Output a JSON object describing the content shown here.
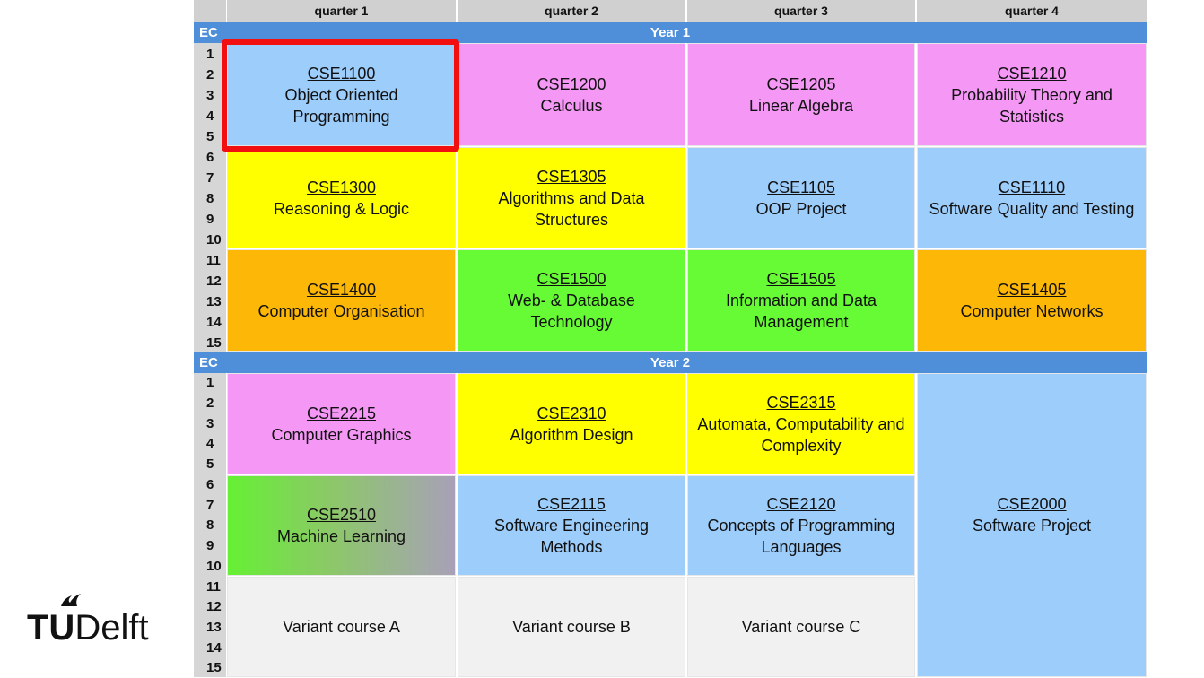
{
  "header": {
    "quarters": [
      "quarter 1",
      "quarter 2",
      "quarter 3",
      "quarter 4"
    ]
  },
  "year1": {
    "ec_label": "EC",
    "title": "Year 1",
    "ec_numbers": [
      "1",
      "2",
      "3",
      "4",
      "5",
      "6",
      "7",
      "8",
      "9",
      "10",
      "11",
      "12",
      "13",
      "14",
      "15"
    ],
    "courses": [
      {
        "code": "CSE1100",
        "name": "Object Oriented Programming",
        "color": "#9dcdfb"
      },
      {
        "code": "CSE1200",
        "name": "Calculus",
        "color": "#f597f5"
      },
      {
        "code": "CSE1205",
        "name": "Linear Algebra",
        "color": "#f597f5"
      },
      {
        "code": "CSE1210",
        "name": "Probability Theory and Statistics",
        "color": "#f597f5"
      },
      {
        "code": "CSE1300",
        "name": "Reasoning & Logic",
        "color": "#ffff00"
      },
      {
        "code": "CSE1305",
        "name": "Algorithms and Data Structures",
        "color": "#ffff00"
      },
      {
        "code": "CSE1105",
        "name": "OOP Project",
        "color": "#9dcdfb"
      },
      {
        "code": "CSE1110",
        "name": "Software Quality and Testing",
        "color": "#9dcdfb"
      },
      {
        "code": "CSE1400",
        "name": "Computer Organisation",
        "color": "#fdb707"
      },
      {
        "code": "CSE1500",
        "name": "Web- & Database Technology",
        "color": "#66fb34"
      },
      {
        "code": "CSE1505",
        "name": "Information and Data Management",
        "color": "#66fb34"
      },
      {
        "code": "CSE1405",
        "name": "Computer Networks",
        "color": "#fdb707"
      }
    ]
  },
  "year2": {
    "ec_label": "EC",
    "title": "Year 2",
    "ec_numbers": [
      "1",
      "2",
      "3",
      "4",
      "5",
      "6",
      "7",
      "8",
      "9",
      "10",
      "11",
      "12",
      "13",
      "14",
      "15"
    ],
    "courses": [
      {
        "code": "CSE2215",
        "name": "Computer Graphics",
        "color": "#f597f5"
      },
      {
        "code": "CSE2310",
        "name": "Algorithm Design",
        "color": "#ffff00"
      },
      {
        "code": "CSE2315",
        "name": "Automata, Computability and Complexity",
        "color": "#ffff00"
      },
      {
        "code": "CSE2000",
        "name": "Software Project",
        "color": "#9dcdfb"
      },
      {
        "code": "CSE2510",
        "name": "Machine Learning",
        "color": "#66f034"
      },
      {
        "code": "CSE2115",
        "name": "Software Engineering Methods",
        "color": "#9dcdfb"
      },
      {
        "code": "CSE2120",
        "name": "Concepts of Programming Languages",
        "color": "#9dcdfb"
      },
      {
        "code": "",
        "name": "Variant course A",
        "color": "#f1f1f1"
      },
      {
        "code": "",
        "name": "Variant course B",
        "color": "#f1f1f1"
      },
      {
        "code": "",
        "name": "Variant course C",
        "color": "#f1f1f1"
      }
    ]
  },
  "highlight": {
    "color": "#f20f0f",
    "target": "CSE1100"
  },
  "logo": {
    "tu": "TU",
    "delft": "Delft"
  }
}
